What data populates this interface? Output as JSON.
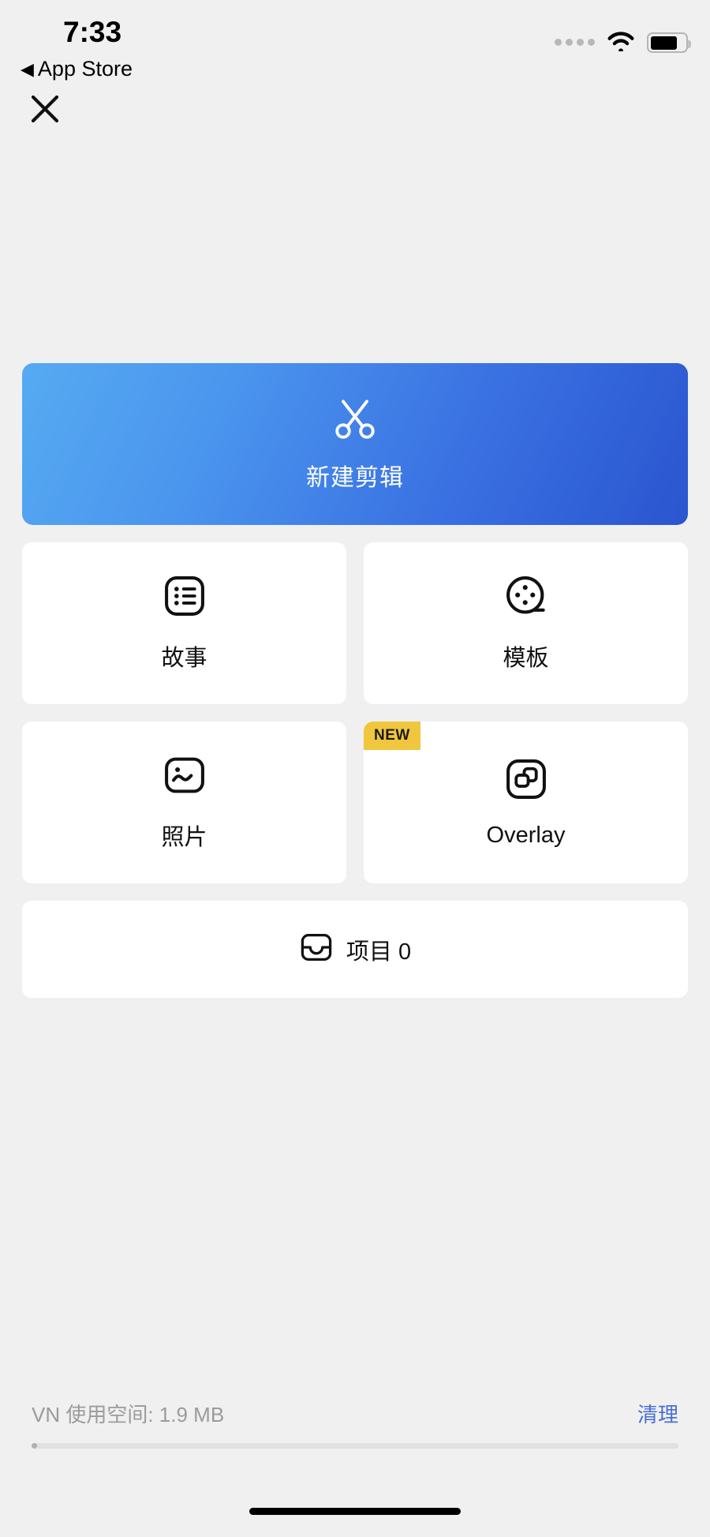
{
  "status_bar": {
    "time": "7:33",
    "back_label": "App Store",
    "back_arrow": "◀",
    "cellular_icon": "signal-dots-icon",
    "wifi_icon": "wifi-icon",
    "battery_icon": "battery-icon",
    "battery_level_pct": 78
  },
  "navigation": {
    "close_icon": "close-icon"
  },
  "hero": {
    "label": "新建剪辑",
    "icon": "scissors-icon",
    "gradient_start": "#56aaf2",
    "gradient_end": "#2a55cf"
  },
  "tiles": [
    {
      "label": "故事",
      "icon": "list-square-icon",
      "badge": null,
      "latin": false
    },
    {
      "label": "模板",
      "icon": "film-reel-icon",
      "badge": null,
      "latin": false
    },
    {
      "label": "照片",
      "icon": "photo-square-icon",
      "badge": null,
      "latin": false
    },
    {
      "label": "Overlay",
      "icon": "layers-square-icon",
      "badge": "NEW",
      "latin": true
    }
  ],
  "projects": {
    "label": "项目 0",
    "icon": "inbox-icon"
  },
  "footer": {
    "storage_text": "VN 使用空间: 1.9 MB",
    "clean_label": "清理",
    "progress_pct": 1,
    "accent_color": "#4a6fd4",
    "badge_color": "#f0c63e"
  }
}
